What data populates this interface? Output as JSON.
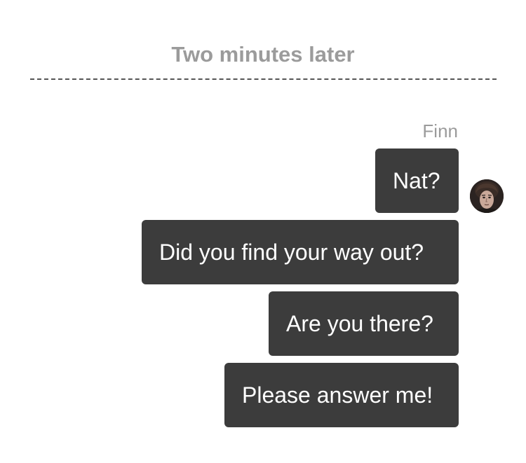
{
  "divider": {
    "label": "Two minutes later"
  },
  "sender": {
    "name": "Finn",
    "avatar_icon": "user-avatar-portrait"
  },
  "messages": [
    {
      "text": "Nat?"
    },
    {
      "text": "Did you find your way out?"
    },
    {
      "text": "Are you there?"
    },
    {
      "text": "Please answer me!"
    }
  ],
  "colors": {
    "bubble_background": "#3c3c3c",
    "bubble_text": "#ffffff",
    "muted_text": "#9b9b9b",
    "divider_line": "#555555",
    "page_background": "#ffffff"
  }
}
